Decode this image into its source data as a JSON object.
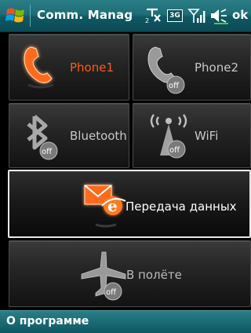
{
  "title_bar": {
    "title": "Comm. Manag",
    "network_type": "3G",
    "ok_label": "ok"
  },
  "tiles": {
    "phone1": {
      "label": "Phone1",
      "icon": "phone-icon",
      "state": "on"
    },
    "phone2": {
      "label": "Phone2",
      "icon": "phone-icon",
      "state": "off",
      "badge": "off"
    },
    "bluetooth": {
      "label": "Bluetooth",
      "icon": "bluetooth-icon",
      "state": "off",
      "badge": "off"
    },
    "wifi": {
      "label": "WiFi",
      "icon": "wifi-icon",
      "state": "off",
      "badge": "off"
    },
    "data": {
      "label": "Передача данных",
      "icon": "data-transfer-icon",
      "state": "on",
      "selected": true
    },
    "flight": {
      "label": "В полёте",
      "icon": "airplane-icon",
      "state": "off",
      "badge": "off"
    }
  },
  "bottom_bar": {
    "softkey_left": "О программе"
  },
  "colors": {
    "accent_on": "#ff5a1a",
    "titlebar": "#1e6d77",
    "label_off": "#c8c8c8"
  }
}
